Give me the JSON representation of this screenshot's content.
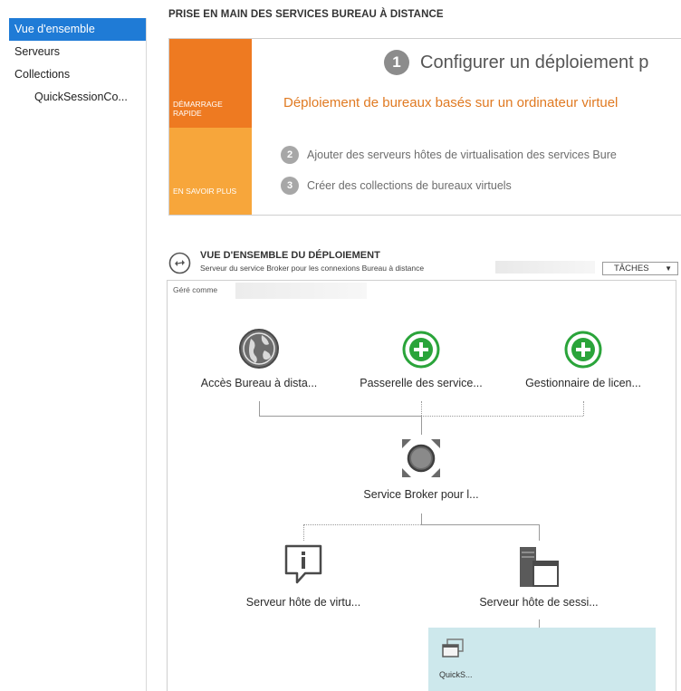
{
  "sidebar": {
    "items": [
      {
        "label": "Vue d'ensemble",
        "active": true
      },
      {
        "label": "Serveurs"
      },
      {
        "label": "Collections"
      },
      {
        "label": "QuickSessionCo..."
      }
    ]
  },
  "quick_start": {
    "section_title": "PRISE EN MAIN DES SERVICES BUREAU À DISTANCE",
    "tile_quick": "DÉMARRAGE RAPIDE",
    "tile_learn": "EN SAVOIR PLUS",
    "step1_number": "1",
    "step1_text": "Configurer un déploiement p",
    "deploy_link": "Déploiement de bureaux basés sur un ordinateur virtuel",
    "step2_number": "2",
    "step2_text": "Ajouter des serveurs hôtes de virtualisation des services Bure",
    "step3_number": "3",
    "step3_text": "Créer des collections de bureaux virtuels"
  },
  "overview": {
    "title": "VUE D'ENSEMBLE DU DÉPLOIEMENT",
    "subtitle": "Serveur du service Broker pour les connexions Bureau à distance",
    "tasks_label": "TÂCHES",
    "managed_label": "Géré comme",
    "nodes": {
      "web_access": "Accès Bureau à dista...",
      "gateway": "Passerelle des service...",
      "licensing": "Gestionnaire de licen...",
      "broker": "Service Broker pour l...",
      "virtualization_host": "Serveur hôte de virtu...",
      "session_host": "Serveur hôte de sessi...",
      "collection": "QuickS..."
    }
  },
  "colors": {
    "nav_active": "#1f7bd6",
    "tile_quick": "#ee7a21",
    "tile_learn": "#f7a63b",
    "link_orange": "#e07a22",
    "plus_green": "#2aa43a",
    "collection_bg": "#cde8ec"
  },
  "icons": [
    "globe-icon",
    "plus-icon",
    "broker-icon",
    "info-icon",
    "server-icon",
    "window-icon",
    "deployment-overview-icon",
    "chevron-down-icon"
  ]
}
